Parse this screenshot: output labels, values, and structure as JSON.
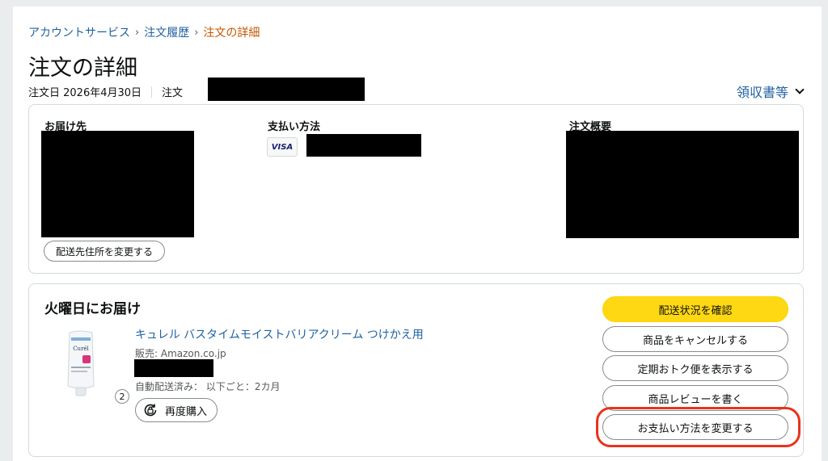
{
  "breadcrumb": {
    "items": [
      "アカウントサービス",
      "注文履歴"
    ],
    "current": "注文の詳細",
    "separator": "›"
  },
  "page_title": "注文の詳細",
  "order_meta": {
    "date_label": "注文日 2026年4月30日",
    "order_label": "注文"
  },
  "receipt_menu": {
    "label": "領収書等",
    "icon": "chevron-down-icon"
  },
  "info_box": {
    "ship_to": {
      "heading": "お届け先",
      "change_button": "配送先住所を変更する"
    },
    "payment": {
      "heading": "支払い方法",
      "card_brand": "VISA"
    },
    "summary": {
      "heading": "注文概要"
    }
  },
  "shipment": {
    "title": "火曜日にお届け",
    "product": {
      "title": "キュレル バスタイムモイストバリアクリーム つけかえ用",
      "seller": "販売: Amazon.co.jp",
      "subscription": "自動配送済み： 以下ごと：2カ月",
      "quantity": "2",
      "image_brand": "Curél",
      "rebuy_button": "再度購入"
    },
    "actions": {
      "track": "配送状況を確認",
      "cancel": "商品をキャンセルする",
      "subscribe_save": "定期おトク便を表示する",
      "review": "商品レビューを書く",
      "change_payment": "お支払い方法を変更する"
    }
  },
  "colors": {
    "link": "#2162a1",
    "current_crumb": "#c45500",
    "primary_button": "#ffd814",
    "highlight_ring": "#e8331c"
  }
}
